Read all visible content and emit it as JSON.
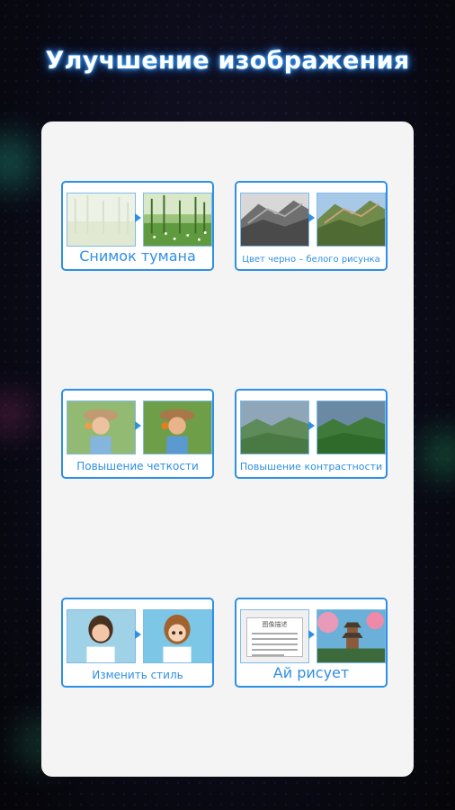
{
  "header": {
    "title": "Улучшение изображения"
  },
  "cards": [
    {
      "label": "Снимок тумана"
    },
    {
      "label": "Цвет черно – белого рисунка"
    },
    {
      "label": "Повышение четкости"
    },
    {
      "label": "Повышение контрастности"
    },
    {
      "label": "Изменить стиль"
    },
    {
      "label": "Ай рисует"
    }
  ],
  "doc_sample": {
    "title": "图像描述"
  },
  "colors": {
    "accent": "#2e8fe6",
    "panel": "#f4f4f4",
    "glow": "#39a6ff"
  }
}
